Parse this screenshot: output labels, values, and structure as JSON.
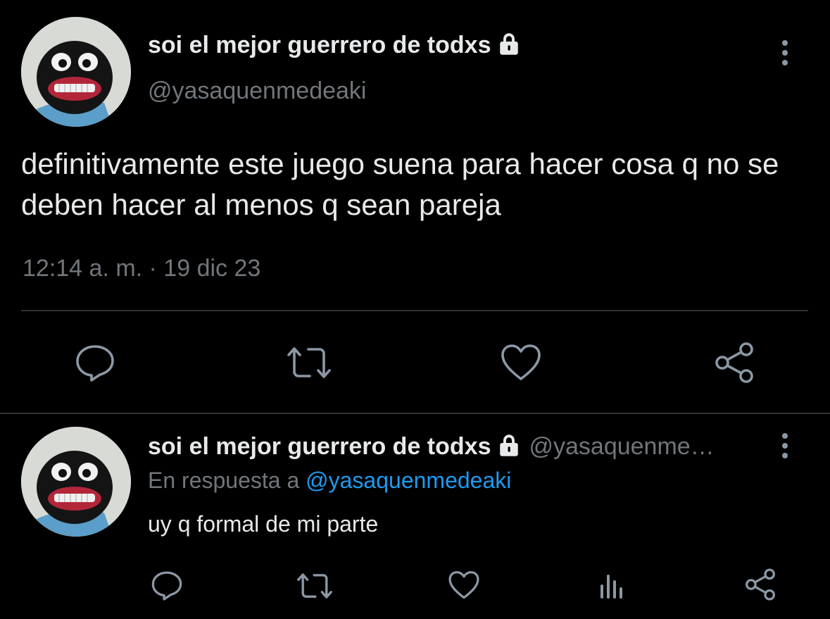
{
  "main_tweet": {
    "display_name": "soi el mejor guerrero de todxs",
    "handle": "@yasaquenmedeaki",
    "text": "definitivamente este juego suena para hacer cosa q no se deben hacer al menos q sean pareja",
    "timestamp": "12:14 a. m. · 19 dic 23",
    "icons": {
      "protected": "lock-icon",
      "more": "more-vertical-icon",
      "actions": [
        "reply-icon",
        "retweet-icon",
        "like-icon",
        "share-icon"
      ]
    }
  },
  "reply_tweet": {
    "display_name": "soi el mejor guerrero de todxs",
    "handle_truncated": "@yasaquenme…",
    "reply_prefix": "En respuesta a",
    "reply_to": "@yasaquenmedeaki",
    "text": "uy q formal de mi parte",
    "icons": {
      "protected": "lock-icon",
      "more": "more-vertical-icon",
      "actions": [
        "reply-icon",
        "retweet-icon",
        "like-icon",
        "analytics-icon",
        "share-icon"
      ]
    }
  },
  "colors": {
    "background": "#000000",
    "text_primary": "#e7e9ea",
    "text_secondary": "#71767b",
    "divider": "#2f3336",
    "link": "#1d9bf0",
    "icon": "#8b98a5"
  }
}
